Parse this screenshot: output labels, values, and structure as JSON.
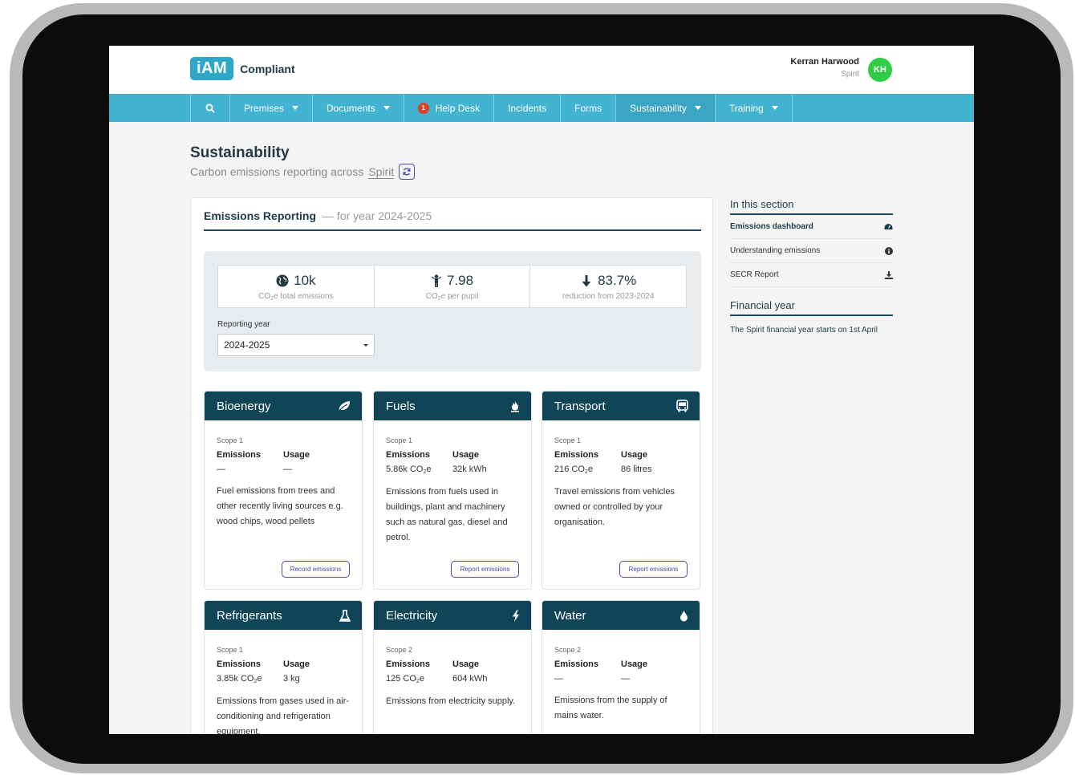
{
  "header": {
    "logo_badge": "iAM",
    "logo_text": "Compliant",
    "user_name": "Kerran Harwood",
    "user_org": "Spirit",
    "avatar_initials": "KH"
  },
  "nav": {
    "items": [
      "Premises",
      "Documents",
      "Help Desk",
      "Incidents",
      "Forms",
      "Sustainability",
      "Training"
    ],
    "helpdesk_badge": "1",
    "active": "Sustainability"
  },
  "page": {
    "title": "Sustainability",
    "subtitle": "Carbon emissions reporting across",
    "org_link": "Spirit"
  },
  "panel": {
    "title": "Emissions Reporting",
    "year_suffix": "— for year 2024-2025",
    "stats": [
      {
        "value": "10k",
        "label_pre": "CO",
        "label_sub": "2",
        "label_post": "e total emissions",
        "icon": "globe-icon"
      },
      {
        "value": "7.98",
        "label_pre": "CO",
        "label_sub": "2",
        "label_post": "e per pupil",
        "icon": "pupil-icon"
      },
      {
        "value": "83.7%",
        "label": "reduction from 2023-2024",
        "icon": "arrow-down-icon"
      }
    ],
    "reporting_year_label": "Reporting year",
    "reporting_year_value": "2024-2025"
  },
  "cards": [
    {
      "title": "Bioenergy",
      "icon": "leaf-icon",
      "scope": "Scope 1",
      "emissions_h": "Emissions",
      "usage_h": "Usage",
      "emissions": "—",
      "usage": "—",
      "desc": "Fuel emissions from trees and other recently living sources e.g. wood chips, wood pellets",
      "button": "Record emissions"
    },
    {
      "title": "Fuels",
      "icon": "fuel-icon",
      "scope": "Scope 1",
      "emissions_h": "Emissions",
      "usage_h": "Usage",
      "emissions_pre": "5.86k CO",
      "emissions_post": "e",
      "usage": "32k kWh",
      "desc": "Emissions from fuels used in buildings, plant and machinery such as natural gas, diesel and petrol.",
      "button": "Report emissions"
    },
    {
      "title": "Transport",
      "icon": "bus-icon",
      "scope": "Scope 1",
      "emissions_h": "Emissions",
      "usage_h": "Usage",
      "emissions_pre": "216 CO",
      "emissions_post": "e",
      "usage": "86 litres",
      "desc": "Travel emissions from vehicles owned or controlled by your organisation.",
      "button": "Report emissions"
    },
    {
      "title": "Refrigerants",
      "icon": "flask-icon",
      "scope": "Scope 1",
      "emissions_h": "Emissions",
      "usage_h": "Usage",
      "emissions_pre": "3.85k CO",
      "emissions_post": "e",
      "usage": "3 kg",
      "desc": "Emissions from gases used in air-conditioning and refrigeration equipment."
    },
    {
      "title": "Electricity",
      "icon": "bolt-icon",
      "scope": "Scope 2",
      "emissions_h": "Emissions",
      "usage_h": "Usage",
      "emissions_pre": "125 CO",
      "emissions_post": "e",
      "usage": "604 kWh",
      "desc": "Emissions from electricity supply."
    },
    {
      "title": "Water",
      "icon": "drop-icon",
      "scope": "Scope 2",
      "emissions_h": "Emissions",
      "usage_h": "Usage",
      "emissions": "—",
      "usage": "—",
      "desc": "Emissions from the supply of mains water."
    }
  ],
  "sidebar": {
    "section_title": "In this section",
    "items": [
      {
        "label": "Emissions dashboard",
        "icon": "dashboard-icon"
      },
      {
        "label": "Understanding emissions",
        "icon": "info-icon"
      },
      {
        "label": "SECR Report",
        "icon": "download-icon"
      }
    ],
    "fy_title": "Financial year",
    "fy_text": "The Spirit financial year starts on 1st April"
  },
  "colors": {
    "nav": "#42b4d2",
    "card_header": "#0f4556",
    "accent_button": "#4848b0",
    "avatar": "#2fcc44"
  }
}
